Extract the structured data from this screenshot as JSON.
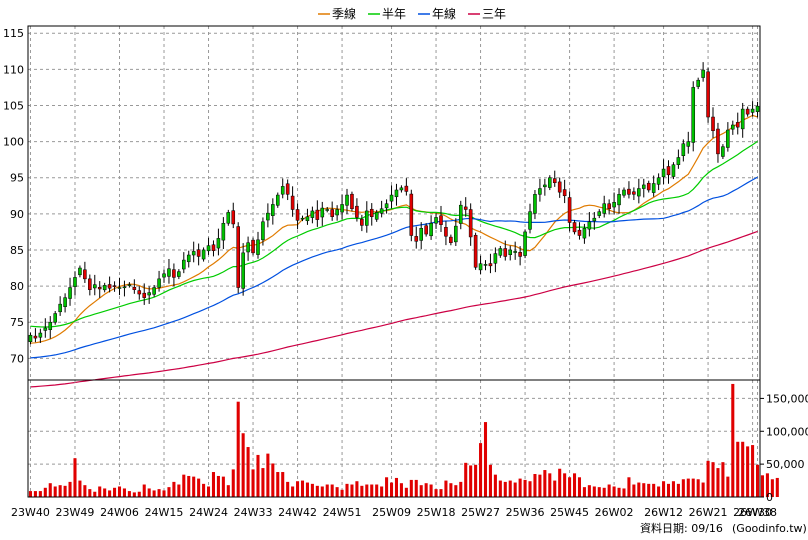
{
  "chart_data": [
    {
      "type": "candlestick",
      "legend_placement": "top-center",
      "legend": [
        {
          "name": "季線",
          "color": "#e07b00"
        },
        {
          "name": "半年",
          "color": "#00cc00"
        },
        {
          "name": "年線",
          "color": "#0050e0"
        },
        {
          "name": "三年",
          "color": "#cc0044"
        }
      ],
      "y_ticks": [
        70,
        75,
        80,
        85,
        90,
        95,
        100,
        105,
        110,
        115
      ],
      "ylim": [
        67,
        116
      ],
      "x_ticks": [
        "23W40",
        "23W49",
        "24W06",
        "24W15",
        "24W24",
        "24W33",
        "24W42",
        "24W51",
        "25W09",
        "25W18",
        "25W27",
        "25W36",
        "25W45",
        "26W02",
        "26W12",
        "26W21",
        "26W30",
        "26W38"
      ],
      "grid": true,
      "colors": {
        "up": "#00c000",
        "down": "#e00000",
        "grid": "#999999"
      },
      "close": [
        73.2,
        72.8,
        73.5,
        74.2,
        75.0,
        76.2,
        77.5,
        78.4,
        79.8,
        81.2,
        82.5,
        81.0,
        79.5,
        80.2,
        79.6,
        80.1,
        79.7,
        80.0,
        79.8,
        79.9,
        80.2,
        79.5,
        78.9,
        78.4,
        79.1,
        79.8,
        81.0,
        81.7,
        82.4,
        81.2,
        82.0,
        83.6,
        84.3,
        84.8,
        84.1,
        85.0,
        85.6,
        84.9,
        86.6,
        88.7,
        90.2,
        88.6,
        79.8,
        84.6,
        86.0,
        84.6,
        86.4,
        88.9,
        90.1,
        91.3,
        92.6,
        93.8,
        92.7,
        90.6,
        89.1,
        89.4,
        89.6,
        90.4,
        89.2,
        90.8,
        90.6,
        89.6,
        90.6,
        91.3,
        92.6,
        90.7,
        89.5,
        88.4,
        90.4,
        89.6,
        90.2,
        90.7,
        91.4,
        92.6,
        93.3,
        93.6,
        93.1,
        87.0,
        86.2,
        88.0,
        87.2,
        88.7,
        89.5,
        88.5,
        86.9,
        86.0,
        88.3,
        91.2,
        90.6,
        86.8,
        82.6,
        83.1,
        83.0,
        82.8,
        84.5,
        85.2,
        84.1,
        85.0,
        84.8,
        84.1,
        87.5,
        90.3,
        92.7,
        93.5,
        94.0,
        95.0,
        94.3,
        93.0,
        92.5,
        88.8,
        87.5,
        87.0,
        88.0,
        88.9,
        89.4,
        90.3,
        91.4,
        90.7,
        91.6,
        92.7,
        93.3,
        92.7,
        92.7,
        93.5,
        94.0,
        93.3,
        94.2,
        95.0,
        96.2,
        95.4,
        96.8,
        97.8,
        99.7,
        100.0,
        107.5,
        108.5,
        109.9,
        103.4,
        101.5,
        98.3,
        99.3,
        101.6,
        102.3,
        102.0,
        104.5,
        103.8,
        104.5,
        104.9
      ],
      "volume_axis": {
        "ticks": [
          0,
          50000,
          100000,
          150000
        ],
        "tick_labels": [
          "0",
          "50,000",
          "100,000",
          "150,000"
        ],
        "ylim": [
          0,
          178000
        ],
        "color": "#e00000"
      },
      "volume": [
        9000,
        9000,
        9000,
        14000,
        21000,
        16000,
        18000,
        17000,
        23000,
        59000,
        25000,
        18000,
        12000,
        8000,
        16000,
        13000,
        10000,
        14000,
        16000,
        13000,
        9000,
        7000,
        8000,
        19000,
        13000,
        10000,
        12000,
        10000,
        15000,
        23000,
        19000,
        34000,
        32000,
        31000,
        28000,
        20000,
        16000,
        38000,
        32000,
        31000,
        18000,
        42000,
        145000,
        97000,
        76000,
        42000,
        64000,
        44000,
        66000,
        51000,
        38000,
        38000,
        23000,
        16000,
        24000,
        25000,
        22000,
        20000,
        17000,
        16000,
        19000,
        19000,
        15000,
        11000,
        20000,
        19000,
        24000,
        17000,
        19000,
        19000,
        19000,
        16000,
        30000,
        22000,
        29000,
        21000,
        14000,
        26000,
        26000,
        18000,
        21000,
        19000,
        12000,
        12000,
        25000,
        21000,
        18000,
        23000,
        52000,
        48000,
        49000,
        82000,
        114000,
        49000,
        34000,
        25000,
        23000,
        25000,
        22000,
        28000,
        26000,
        24000,
        35000,
        34000,
        41000,
        36000,
        25000,
        43000,
        36000,
        30000,
        36000,
        30000,
        15000,
        18000,
        16000,
        15000,
        14000,
        19000,
        16000,
        14000,
        13000,
        30000,
        19000,
        22000,
        21000,
        20000,
        20000,
        16000,
        24000,
        20000,
        24000,
        20000,
        27000,
        28000,
        28000,
        27000,
        22000,
        55000,
        53000,
        44000,
        53000,
        31000,
        172000,
        84000,
        84000,
        77000,
        79000,
        49000,
        33000,
        36000,
        27000,
        29000
      ],
      "x_start_week": "23W40"
    }
  ],
  "footer": {
    "date_text": "資料日期: 09/16",
    "source_text": "(Goodinfo.tw)"
  }
}
